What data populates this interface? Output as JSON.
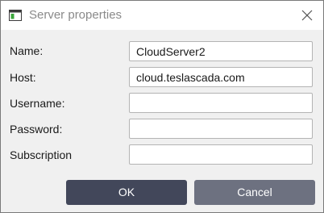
{
  "window": {
    "title": "Server properties",
    "icon": "window-app-icon",
    "close_icon": "close-icon"
  },
  "form": {
    "fields": [
      {
        "label": "Name:",
        "value": "CloudServer2",
        "placeholder": ""
      },
      {
        "label": "Host:",
        "value": "cloud.teslascada.com",
        "placeholder": ""
      },
      {
        "label": "Username:",
        "value": "",
        "placeholder": ""
      },
      {
        "label": "Password:",
        "value": "",
        "placeholder": ""
      },
      {
        "label": "Subscription",
        "value": "",
        "placeholder": ""
      }
    ]
  },
  "buttons": {
    "ok_label": "OK",
    "cancel_label": "Cancel"
  },
  "colors": {
    "ok_button": "#42475a",
    "cancel_button": "#6d7180",
    "dialog_background": "#f0f0f0",
    "titlebar_background": "#ffffff"
  }
}
